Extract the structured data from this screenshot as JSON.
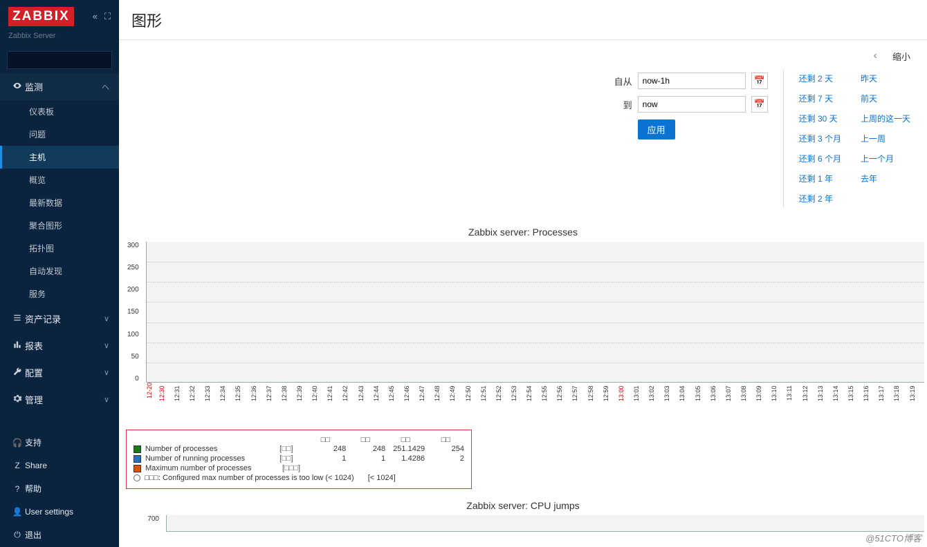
{
  "brand": {
    "logo": "ZABBIX",
    "subtitle": "Zabbix Server"
  },
  "sidebar": {
    "search_placeholder": "",
    "sections": [
      {
        "label": "监测",
        "open": true,
        "items": [
          "仪表板",
          "问题",
          "主机",
          "概览",
          "最新数据",
          "聚合图形",
          "拓扑图",
          "自动发现",
          "服务"
        ],
        "active": 2
      },
      {
        "label": "资产记录"
      },
      {
        "label": "报表"
      },
      {
        "label": "配置"
      },
      {
        "label": "管理"
      }
    ],
    "bottom": [
      "支持",
      "Share",
      "帮助",
      "User settings",
      "退出"
    ]
  },
  "page": {
    "title": "图形",
    "zoom_label": "缩小",
    "from_label": "自从",
    "to_label": "到",
    "from_value": "now-1h",
    "to_value": "now",
    "apply_label": "应用"
  },
  "quick_links": {
    "col1": [
      "还剩 2 天",
      "还剩 7 天",
      "还剩 30 天",
      "还剩 3 个月",
      "还剩 6 个月",
      "还剩 1 年",
      "还剩 2 年"
    ],
    "col2": [
      "昨天",
      "前天",
      "上周的这一天",
      "上一周",
      "上一个月",
      "去年"
    ]
  },
  "chart_data": [
    {
      "type": "line",
      "title": "Zabbix server: Processes",
      "ylabel": "",
      "ylim": [
        0,
        300
      ],
      "yticks": [
        300,
        250,
        200,
        150,
        100,
        50,
        0
      ],
      "x_date": "12-20",
      "xticks": [
        "12:30",
        "12:31",
        "12:32",
        "12:33",
        "12:34",
        "12:35",
        "12:36",
        "12:37",
        "12:38",
        "12:39",
        "12:40",
        "12:41",
        "12:42",
        "12:43",
        "12:44",
        "12:45",
        "12:46",
        "12:47",
        "12:48",
        "12:49",
        "12:50",
        "12:51",
        "12:52",
        "12:53",
        "12:54",
        "12:55",
        "12:56",
        "12:57",
        "12:58",
        "12:59",
        "13:00",
        "13:01",
        "13:02",
        "13:03",
        "13:04",
        "13:05",
        "13:06",
        "13:07",
        "13:08",
        "13:09",
        "13:10",
        "13:11",
        "13:12",
        "13:13",
        "13:14",
        "13:15",
        "13:16",
        "13:17",
        "13:18",
        "13:19"
      ],
      "xticks_red": [
        0,
        30
      ],
      "legend_header": [
        "□□",
        "□□",
        "□□",
        "□□"
      ],
      "series": [
        {
          "name": "Number of processes",
          "color": "#1a7a1a",
          "tag": "[□□]",
          "vals": [
            248,
            248,
            251.1429,
            254
          ]
        },
        {
          "name": "Number of running processes",
          "color": "#2d6fb8",
          "tag": "[□□]",
          "vals": [
            1,
            1,
            1.4286,
            2
          ]
        },
        {
          "name": "Maximum number of processes",
          "color": "#d9540b",
          "tag": "[□□□]",
          "vals": []
        }
      ],
      "trigger": {
        "text": "□□□: Configured max number of processes is too low (< 1024)",
        "cond": "[< 1024]"
      }
    },
    {
      "type": "line",
      "title": "Zabbix server: CPU jumps",
      "ylim": [
        0,
        700
      ],
      "ytick_top": 700
    }
  ],
  "watermark": "@51CTO博客"
}
